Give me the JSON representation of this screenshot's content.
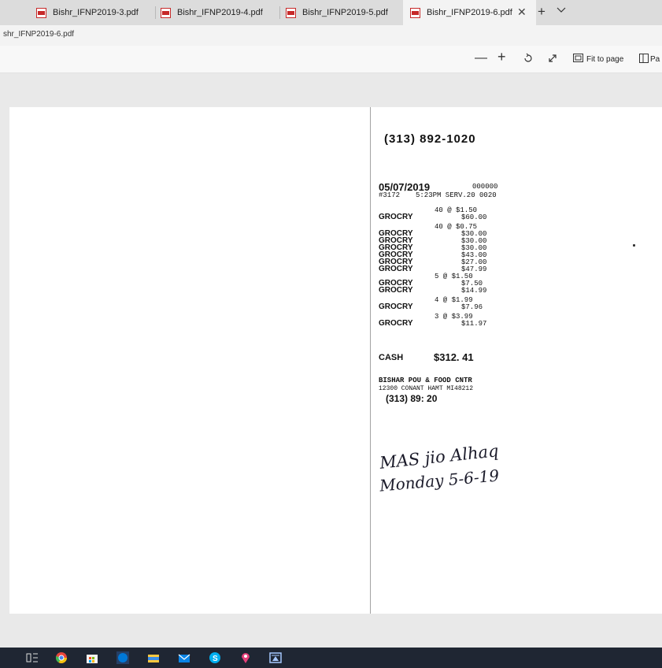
{
  "tabs": [
    {
      "label": "Bishr_IFNP2019-3.pdf"
    },
    {
      "label": "Bishr_IFNP2019-4.pdf"
    },
    {
      "label": "Bishr_IFNP2019-5.pdf"
    },
    {
      "label": "Bishr_IFNP2019-6.pdf",
      "active": true
    }
  ],
  "address": {
    "text": "shr_IFNP2019-6.pdf"
  },
  "toolbar": {
    "fit_label": "Fit to page",
    "page_label": "Pa"
  },
  "receipt": {
    "phone_top": "(313) 892-1020",
    "date": "05/07/2019",
    "code": "000000",
    "store_no": "#3172",
    "time_serv": "5:23PM SERV.20 0020",
    "items": [
      {
        "qty": "40 @ $1.50",
        "name": "GROCRY",
        "price": "$60.00"
      },
      {
        "qty": "40 @ $0.75",
        "name": "GROCRY",
        "price": "$30.00"
      },
      {
        "qty": "",
        "name": "GROCRY",
        "price": "$30.00"
      },
      {
        "qty": "",
        "name": "GROCRY",
        "price": "$30.00"
      },
      {
        "qty": "",
        "name": "GROCRY",
        "price": "$43.00"
      },
      {
        "qty": "",
        "name": "GROCRY",
        "price": "$27.00"
      },
      {
        "qty": "",
        "name": "GROCRY",
        "price": "$47.99"
      },
      {
        "qty": "5 @ $1.50",
        "name": "GROCRY",
        "price": "$7.50"
      },
      {
        "qty": "",
        "name": "GROCRY",
        "price": "$14.99"
      },
      {
        "qty": "4 @ $1.99",
        "name": "GROCRY",
        "price": "$7.96"
      },
      {
        "qty": "3 @ $3.99",
        "name": "GROCRY",
        "price": "$11.97"
      }
    ],
    "cash_label": "CASH",
    "cash_total": "$312. 41",
    "store_name": "BISHAR POU  & FOOD CNTR",
    "store_addr": "12300 CONANT HAMT   MI48212",
    "store_phone": "(313) 89:   20"
  },
  "signature": {
    "line1": "MAS jio Alhaq",
    "line2": "Monday 5-6-19"
  },
  "taskbar_icons": [
    "task-view-icon",
    "chrome-icon",
    "store-icon",
    "edge-icon",
    "file-explorer-icon",
    "mail-icon",
    "skype-icon",
    "maps-icon",
    "photos-icon"
  ]
}
